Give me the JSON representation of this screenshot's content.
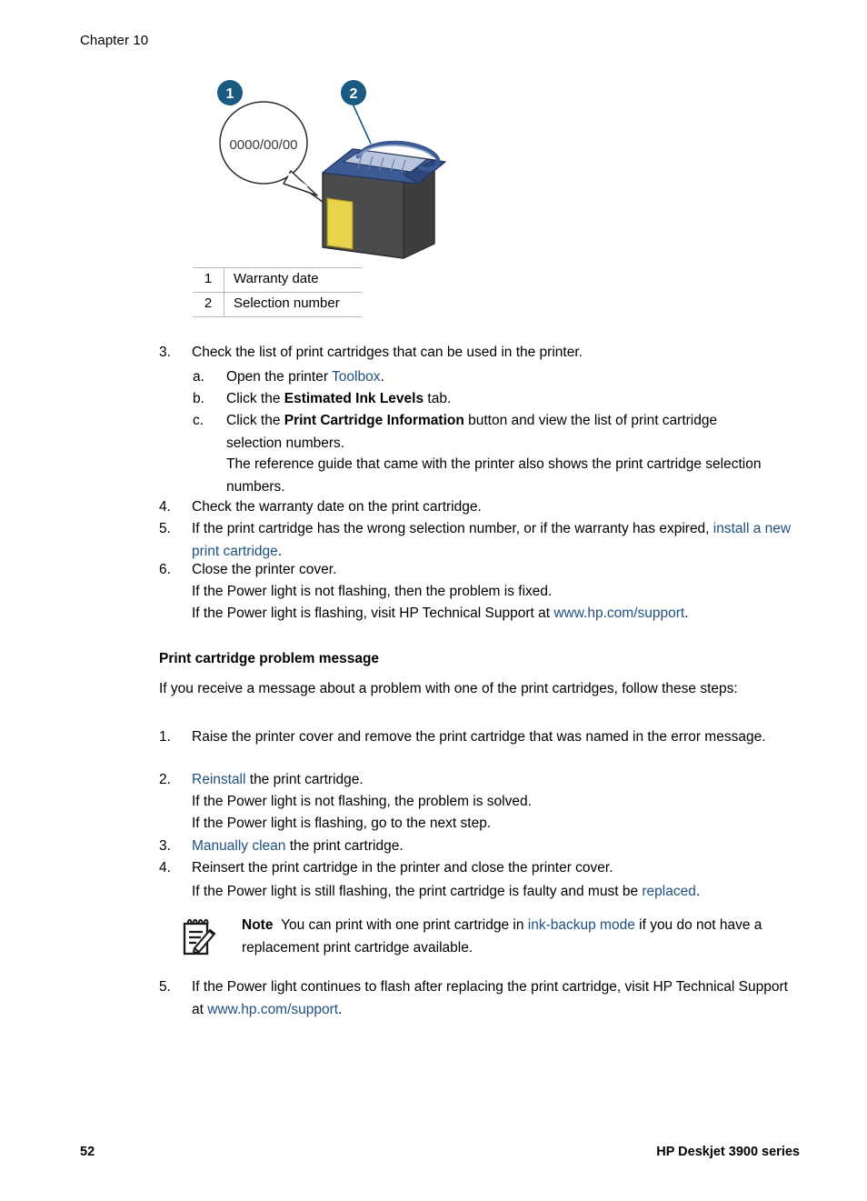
{
  "header": {
    "chapter": "Chapter 10"
  },
  "figure": {
    "name": "print-cartridge-diagram",
    "bubble_text": "0000/00/00",
    "callouts": [
      {
        "number": "1"
      },
      {
        "number": "2"
      }
    ],
    "colors": {
      "callout_badge": "#1a5a80",
      "cartridge_body": "#4b4b4b",
      "cartridge_top": "#3c5a94",
      "cartridge_label": "#e8d44a",
      "outline": "#2b2b2b"
    }
  },
  "legend": {
    "rows": [
      {
        "number": "1",
        "label": "Warranty date"
      },
      {
        "number": "2",
        "label": "Selection number"
      }
    ]
  },
  "list_one": {
    "item3": {
      "number": "3.",
      "text": "Check the list of print cartridges that can be used in the printer.",
      "sub": {
        "a": {
          "marker": "a.",
          "pre": "Open the printer ",
          "link": "Toolbox",
          "post": "."
        },
        "b": {
          "marker": "b.",
          "pre": "Click the ",
          "bold": "Estimated Ink Levels",
          "post": " tab."
        },
        "c": {
          "marker": "c.",
          "pre": "Click the ",
          "bold": "Print Cartridge Information",
          "post": " button and view the list of print cartridge selection numbers."
        }
      },
      "note_line": "The reference guide that came with the printer also shows the print cartridge selection numbers."
    },
    "item4": {
      "number": "4.",
      "text": "Check the warranty date on the print cartridge."
    },
    "item5": {
      "number": "5.",
      "pre": "If the print cartridge has the wrong selection number, or if the warranty has expired, ",
      "link": "install a new print cartridge",
      "post": "."
    },
    "item6": {
      "number": "6.",
      "text": "Close the printer cover.",
      "line2": "If the Power light is not flashing, then the problem is fixed.",
      "line3_pre": "If the Power light is flashing, visit HP Technical Support at ",
      "line3_link": "www.hp.com/support",
      "line3_post": "."
    }
  },
  "section": {
    "heading": "Print cartridge problem message",
    "intro": "If you receive a message about a problem with one of the print cartridges, follow these steps:"
  },
  "list_two": {
    "item1": {
      "number": "1.",
      "text": "Raise the printer cover and remove the print cartridge that was named in the error message."
    },
    "item2": {
      "number": "2.",
      "link": "Reinstall",
      "post": " the print cartridge.",
      "line2": "If the Power light is not flashing, the problem is solved.",
      "line3": "If the Power light is flashing, go to the next step."
    },
    "item3": {
      "number": "3.",
      "link": "Manually clean",
      "post": " the print cartridge."
    },
    "item4": {
      "number": "4.",
      "text": "Reinsert the print cartridge in the printer and close the printer cover.",
      "line2_pre": "If the Power light is still flashing, the print cartridge is faulty and must be ",
      "line2_link": "replaced",
      "line2_post": "."
    },
    "item5": {
      "number": "5.",
      "pre": "If the Power light continues to flash after replacing the print cartridge, visit HP Technical Support at ",
      "link": "www.hp.com/support",
      "post": "."
    }
  },
  "note": {
    "label": "Note",
    "pre": "You can print with one print cartridge in ",
    "link": "ink-backup mode",
    "post": " if you do not have a replacement print cartridge available."
  },
  "footer": {
    "page_number": "52",
    "product": "HP Deskjet 3900 series"
  }
}
